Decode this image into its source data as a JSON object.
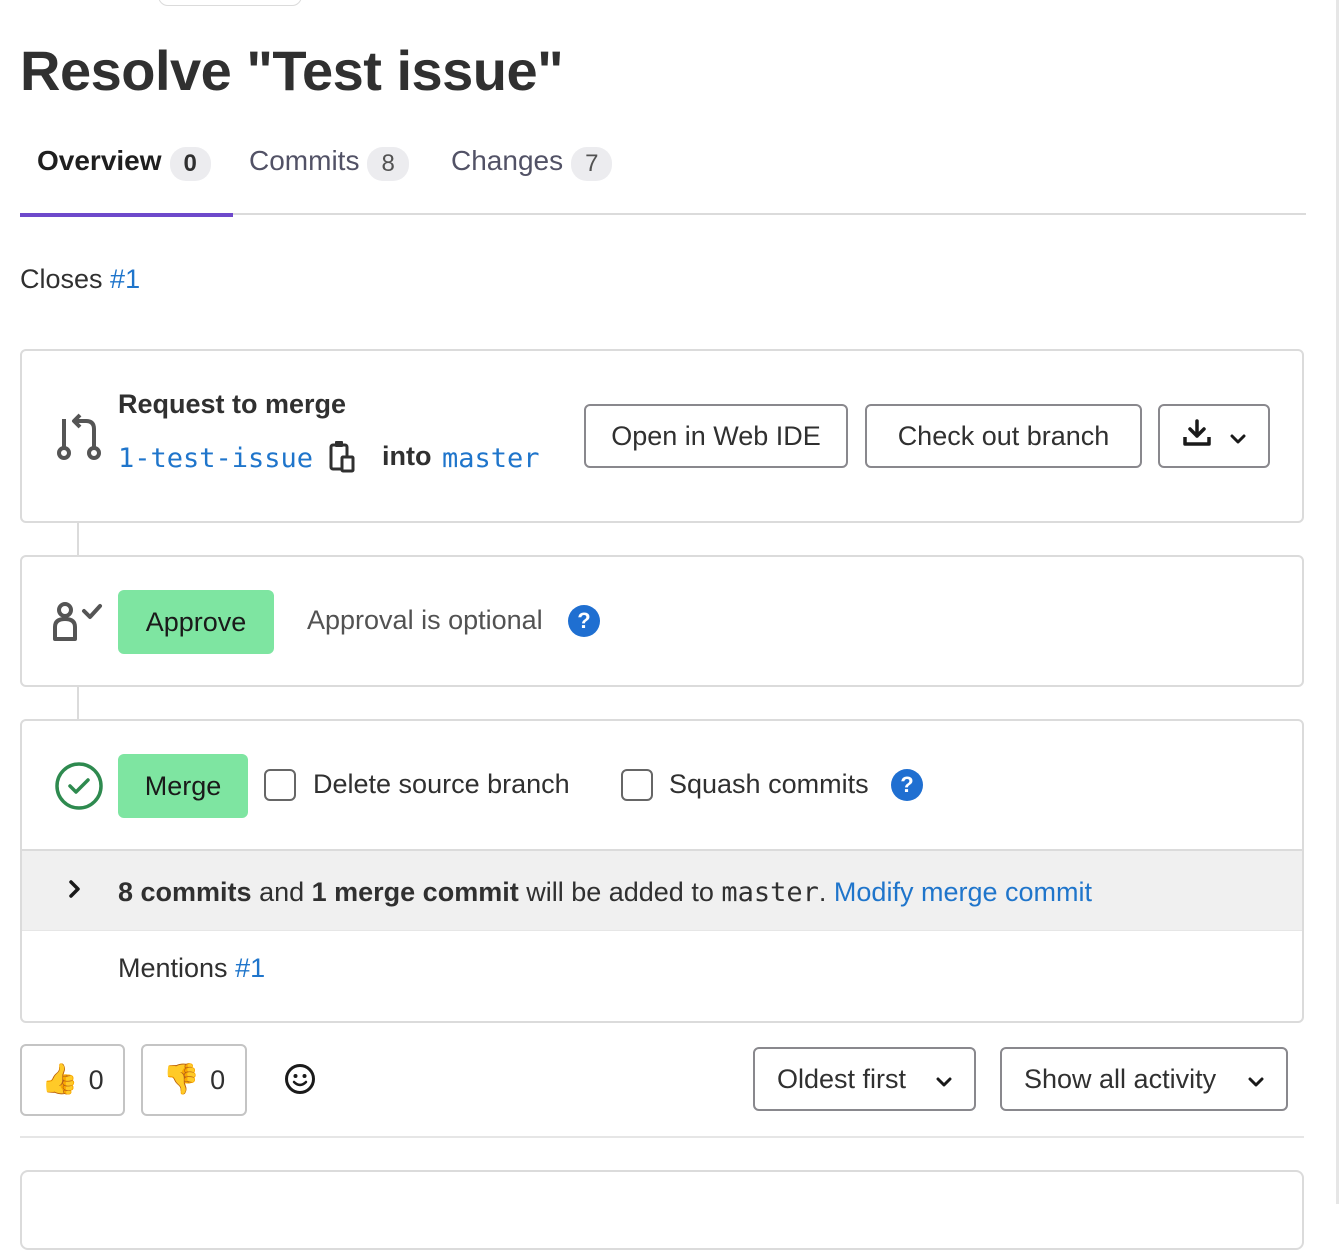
{
  "title": "Resolve \"Test issue\"",
  "tabs": [
    {
      "label": "Overview",
      "count": "0",
      "active": true
    },
    {
      "label": "Commits",
      "count": "8",
      "active": false
    },
    {
      "label": "Changes",
      "count": "7",
      "active": false
    }
  ],
  "description": {
    "prefix": "Closes",
    "issue_link": "#1"
  },
  "merge_request": {
    "heading": "Request to merge",
    "source_branch": "1-test-issue",
    "into_label": "into",
    "target_branch": "master",
    "open_web_ide": "Open in Web IDE",
    "check_out_branch": "Check out branch"
  },
  "approval": {
    "button": "Approve",
    "status": "Approval is optional"
  },
  "merge": {
    "button": "Merge",
    "delete_source_branch": "Delete source branch",
    "squash_commits": "Squash commits",
    "commits_count": "8 commits",
    "and": " and ",
    "merge_commit_count": "1 merge commit",
    "will_be_added": " will be added to ",
    "target": "master",
    "period": ".",
    "modify_link": "Modify merge commit",
    "mentions_prefix": "Mentions",
    "mentions_link": "#1"
  },
  "reactions": {
    "thumbs_up": "0",
    "thumbs_down": "0"
  },
  "sort": {
    "order": "Oldest first",
    "filter": "Show all activity"
  }
}
